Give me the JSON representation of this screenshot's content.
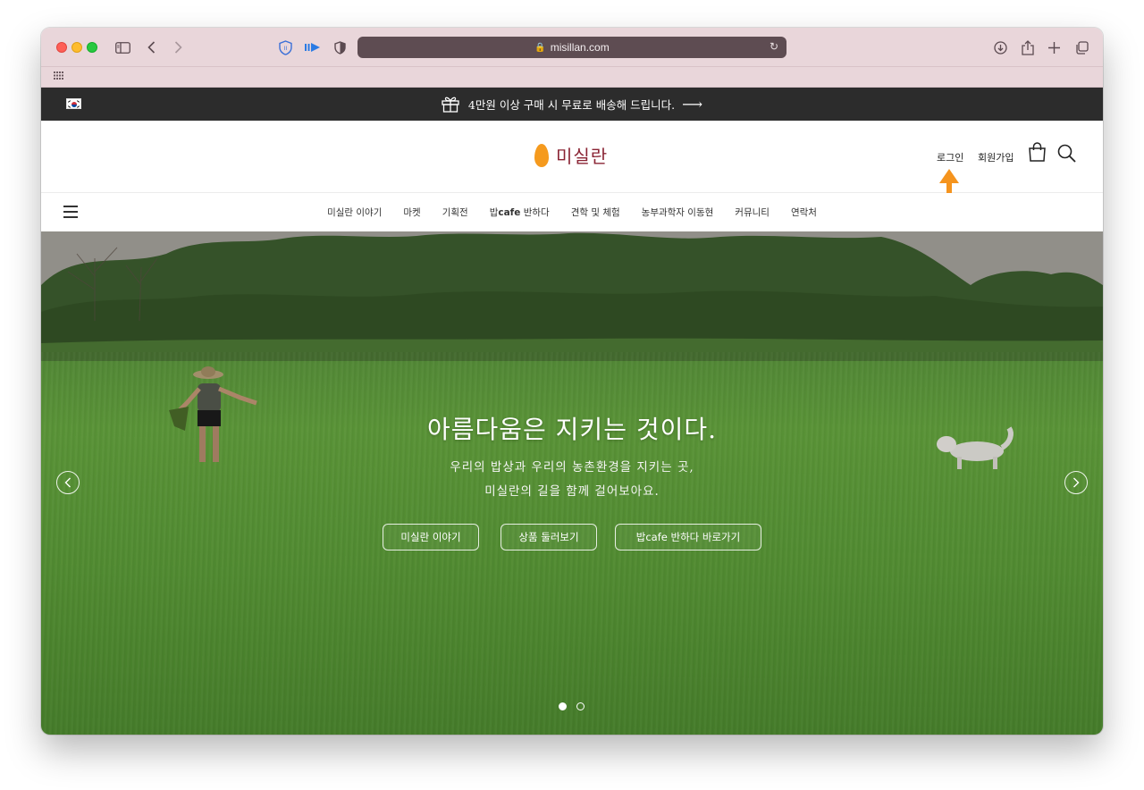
{
  "browser": {
    "url": "misillan.com"
  },
  "promo": {
    "text": "4만원 이상 구매 시 무료로 배송해 드립니다.",
    "arrow": "⟶"
  },
  "header": {
    "logo_text": "미실란",
    "login": "로그인",
    "signup": "회원가입"
  },
  "nav": {
    "items": [
      {
        "label": "미실란 이야기"
      },
      {
        "label": "마켓"
      },
      {
        "label": "기획전"
      },
      {
        "label_prefix": "밥",
        "label_bold": "cafe",
        "label_suffix": " 반하다"
      },
      {
        "label": "견학 및 체험"
      },
      {
        "label": "농부과학자 이동현"
      },
      {
        "label": "커뮤니티"
      },
      {
        "label": "연락처"
      }
    ]
  },
  "hero": {
    "title": "아름다움은 지키는 것이다.",
    "subtitle_line1": "우리의 밥상과 우리의 농촌환경을 지키는 곳,",
    "subtitle_line2": "미실란의 길을 함께 걸어보아요.",
    "buttons": [
      "미실란 이야기",
      "상품 둘러보기",
      "밥cafe 반하다 바로가기"
    ],
    "slide_count": 2,
    "active_slide": 1
  },
  "colors": {
    "promo_bg": "#2c2c2c",
    "logo_text": "#8a2434",
    "logo_grain": "#f59a1e",
    "callout_arrow": "#f5941e",
    "chrome_bg": "#e9d6da"
  }
}
